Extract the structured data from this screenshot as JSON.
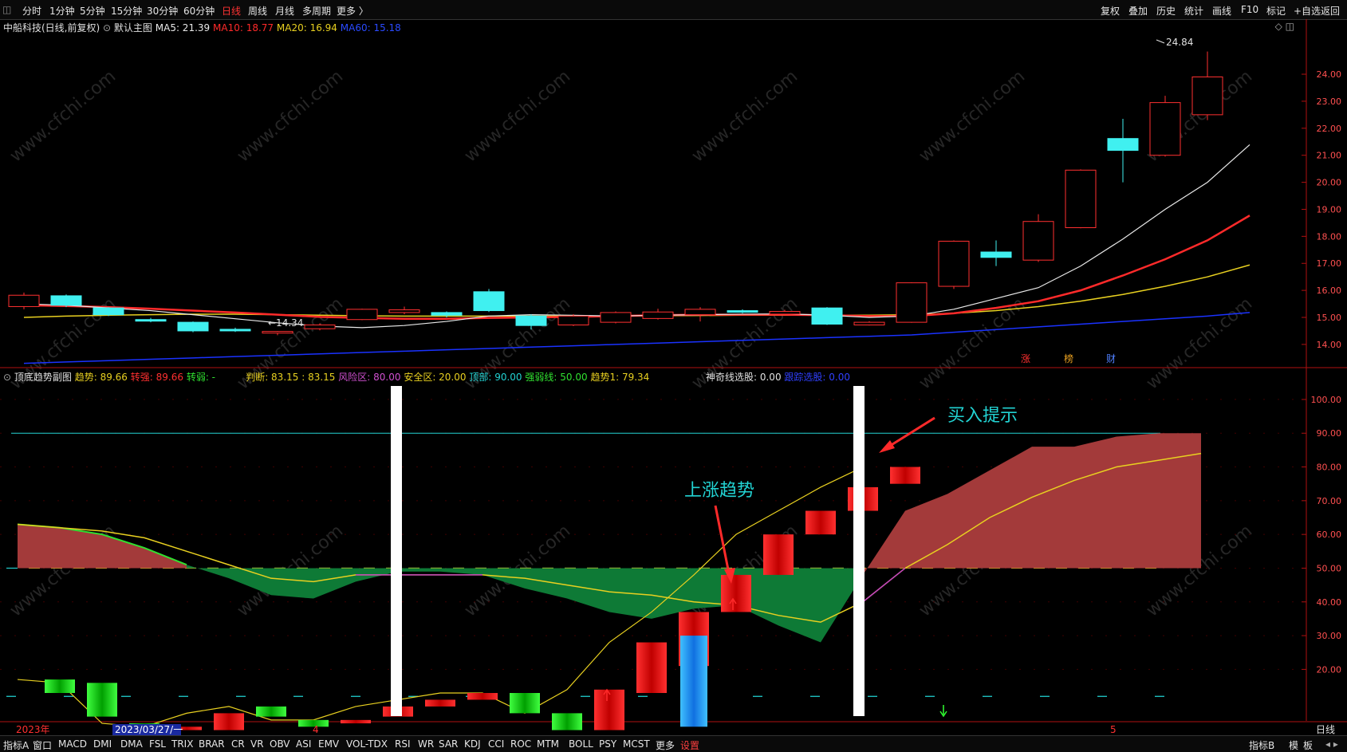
{
  "toolbar": {
    "periods": [
      "分时",
      "1分钟",
      "5分钟",
      "15分钟",
      "30分钟",
      "60分钟",
      "日线",
      "周线",
      "月线",
      "多周期",
      "更多 〉"
    ],
    "active_period": "日线",
    "right_tools": [
      "复权",
      "叠加",
      "历史",
      "统计",
      "画线",
      "F10",
      "标记",
      "+自选",
      "返回"
    ]
  },
  "main_legend": {
    "stock": "中船科技(日线,前复权)",
    "chart_label": "默认主图",
    "ma5": "MA5: 21.39",
    "ma10": "MA10: 18.77",
    "ma20": "MA20: 16.94",
    "ma60": "MA60: 15.18",
    "colors": {
      "ma5": "#e8e8e8",
      "ma10": "#ff2a2a",
      "ma20": "#e8d020",
      "ma60": "#1a32ff"
    }
  },
  "indicator_legend": {
    "name": "顶底趋势副图",
    "trend": "趋势: 89.66",
    "strong": "转强: 89.66",
    "weak": "转弱: -",
    "judge": "判断: 83.15 : 83.15",
    "risk": "风险区: 80.00",
    "safe": "安全区: 20.00",
    "top": "顶部: 90.00",
    "strong_weak_line": "强弱线: 50.00",
    "trend1": "趋势1: 79.34",
    "magic": "神奇线选股: 0.00",
    "follow": "跟踪选股: 0.00"
  },
  "annotations": {
    "buy_hint": "买入提示",
    "uptrend": "上涨趋势",
    "low_label": "←14.34",
    "high_label": "24.84",
    "markers": [
      "涨",
      "榜",
      "财"
    ]
  },
  "date_axis": {
    "year": "2023年",
    "cursor_date": "2023/03/27/一",
    "month4": "4",
    "month5": "5",
    "period_label": "日线"
  },
  "bottom_tabs": [
    "指标A",
    "窗口",
    "MACD",
    "DMI",
    "DMA",
    "FSL",
    "TRIX",
    "BRAR",
    "CR",
    "VR",
    "OBV",
    "ASI",
    "EMV",
    "VOL-TDX",
    "RSI",
    "WR",
    "SAR",
    "KDJ",
    "CCI",
    "ROC",
    "MTM",
    "BOLL",
    "PSY",
    "MCST",
    "更多",
    "设置"
  ],
  "bottom_right": [
    "指标B",
    "模",
    "板"
  ],
  "chart_data": [
    {
      "type": "candlestick",
      "title": "中船科技(日线,前复权)",
      "y_ticks": [
        24.0,
        23.0,
        22.0,
        21.0,
        20.0,
        19.0,
        18.0,
        17.0,
        16.0,
        15.0,
        14.0
      ],
      "ylim": [
        13.2,
        25.3
      ],
      "candles": [
        {
          "o": 15.4,
          "c": 15.82,
          "h": 15.92,
          "l": 15.3
        },
        {
          "o": 15.8,
          "c": 15.45,
          "h": 15.85,
          "l": 15.38
        },
        {
          "o": 15.35,
          "c": 15.1,
          "h": 15.38,
          "l": 15.05
        },
        {
          "o": 14.92,
          "c": 14.9,
          "h": 14.98,
          "l": 14.82
        },
        {
          "o": 14.82,
          "c": 14.5,
          "h": 14.85,
          "l": 14.45
        },
        {
          "o": 14.56,
          "c": 14.5,
          "h": 14.62,
          "l": 14.46
        },
        {
          "o": 14.42,
          "c": 14.48,
          "h": 14.5,
          "l": 14.34
        },
        {
          "o": 14.58,
          "c": 14.72,
          "h": 14.78,
          "l": 14.52
        },
        {
          "o": 14.92,
          "c": 15.3,
          "h": 15.32,
          "l": 14.9
        },
        {
          "o": 15.18,
          "c": 15.28,
          "h": 15.4,
          "l": 15.12
        },
        {
          "o": 15.18,
          "c": 15.08,
          "h": 15.22,
          "l": 15.0
        },
        {
          "o": 15.95,
          "c": 15.25,
          "h": 16.05,
          "l": 15.2
        },
        {
          "o": 15.05,
          "c": 14.7,
          "h": 15.12,
          "l": 14.55
        },
        {
          "o": 14.72,
          "c": 15.05,
          "h": 15.12,
          "l": 14.68
        },
        {
          "o": 14.82,
          "c": 15.18,
          "h": 15.22,
          "l": 14.78
        },
        {
          "o": 14.96,
          "c": 15.2,
          "h": 15.32,
          "l": 14.92
        },
        {
          "o": 15.1,
          "c": 15.3,
          "h": 15.38,
          "l": 14.85
        },
        {
          "o": 15.25,
          "c": 15.22,
          "h": 15.3,
          "l": 15.15
        },
        {
          "o": 15.12,
          "c": 15.22,
          "h": 15.28,
          "l": 15.08
        },
        {
          "o": 15.35,
          "c": 14.75,
          "h": 15.38,
          "l": 14.72
        },
        {
          "o": 14.72,
          "c": 14.82,
          "h": 14.86,
          "l": 14.7
        },
        {
          "o": 14.82,
          "c": 16.28,
          "h": 16.3,
          "l": 14.8
        },
        {
          "o": 16.15,
          "c": 17.82,
          "h": 17.85,
          "l": 16.05
        },
        {
          "o": 17.42,
          "c": 17.22,
          "h": 17.85,
          "l": 16.9
        },
        {
          "o": 17.12,
          "c": 18.55,
          "h": 18.82,
          "l": 17.05
        },
        {
          "o": 18.32,
          "c": 20.45,
          "h": 20.48,
          "l": 18.3
        },
        {
          "o": 21.62,
          "c": 21.18,
          "h": 22.35,
          "l": 20.0
        },
        {
          "o": 21.0,
          "c": 22.95,
          "h": 23.2,
          "l": 20.95
        },
        {
          "o": 22.5,
          "c": 23.9,
          "h": 24.84,
          "l": 22.3
        }
      ],
      "ma5": [
        15.5,
        15.45,
        15.35,
        15.25,
        15.1,
        14.95,
        14.8,
        14.68,
        14.62,
        14.7,
        14.85,
        15.05,
        15.1,
        15.08,
        15.05,
        15.08,
        15.1,
        15.12,
        15.13,
        15.08,
        15.0,
        15.05,
        15.3,
        15.7,
        16.1,
        16.9,
        17.9,
        19.0,
        20.0,
        21.39
      ],
      "ma10": [
        15.45,
        15.42,
        15.38,
        15.32,
        15.25,
        15.18,
        15.1,
        15.02,
        14.98,
        14.95,
        14.95,
        14.98,
        15.0,
        15.02,
        15.05,
        15.08,
        15.1,
        15.1,
        15.1,
        15.08,
        15.05,
        15.05,
        15.15,
        15.35,
        15.6,
        16.0,
        16.55,
        17.15,
        17.85,
        18.77
      ],
      "ma20": [
        15.0,
        15.05,
        15.08,
        15.1,
        15.12,
        15.12,
        15.1,
        15.08,
        15.06,
        15.05,
        15.05,
        15.05,
        15.05,
        15.05,
        15.05,
        15.06,
        15.07,
        15.08,
        15.08,
        15.08,
        15.08,
        15.1,
        15.15,
        15.25,
        15.4,
        15.6,
        15.85,
        16.15,
        16.5,
        16.94
      ],
      "ma60": [
        13.3,
        13.35,
        13.4,
        13.45,
        13.5,
        13.55,
        13.6,
        13.65,
        13.7,
        13.75,
        13.8,
        13.85,
        13.9,
        13.95,
        14.0,
        14.05,
        14.1,
        14.15,
        14.2,
        14.25,
        14.3,
        14.35,
        14.45,
        14.55,
        14.65,
        14.75,
        14.85,
        14.95,
        15.05,
        15.18
      ]
    },
    {
      "type": "area",
      "title": "顶底趋势副图",
      "y_ticks": [
        100,
        90,
        80,
        70,
        60,
        50,
        40,
        30,
        20
      ],
      "ylim": [
        0,
        104
      ],
      "reference_lines": {
        "top": 90,
        "strong_weak": 50,
        "safe": 12
      },
      "trend": [
        63,
        62,
        60,
        56,
        51,
        47,
        42,
        41,
        46,
        49,
        49,
        48,
        44,
        41,
        37,
        35,
        38,
        39,
        33,
        28,
        48,
        67,
        72,
        79,
        86,
        86,
        89,
        90,
        90
      ],
      "trend1": [
        63,
        62,
        61,
        59,
        55,
        51,
        47,
        46,
        48,
        48,
        48,
        48,
        47,
        45,
        43,
        42,
        40,
        39,
        36,
        34,
        40,
        50,
        57,
        65,
        71,
        76,
        80,
        82,
        84
      ],
      "bars": [
        {
          "v": 17,
          "b": 13,
          "color": "green"
        },
        {
          "v": 16,
          "b": 6,
          "color": "green"
        },
        {
          "v": 4,
          "b": 2,
          "color": "green"
        },
        {
          "v": 3,
          "b": 2,
          "color": "red"
        },
        {
          "v": 7,
          "b": 2,
          "color": "red"
        },
        {
          "v": 9,
          "b": 6,
          "color": "green"
        },
        {
          "v": 5,
          "b": 3,
          "color": "green"
        },
        {
          "v": 5,
          "b": 4,
          "color": "red"
        },
        {
          "v": 9,
          "b": 6,
          "color": "red"
        },
        {
          "v": 11,
          "b": 9,
          "color": "red"
        },
        {
          "v": 13,
          "b": 11,
          "color": "red"
        },
        {
          "v": 13,
          "b": 7,
          "color": "green"
        },
        {
          "v": 7,
          "b": 2,
          "color": "green"
        },
        {
          "v": 14,
          "b": 2,
          "color": "red"
        },
        {
          "v": 28,
          "b": 13,
          "color": "red"
        },
        {
          "v": 37,
          "b": 21,
          "color": "red"
        },
        {
          "v": 48,
          "b": 37,
          "color": "red"
        },
        {
          "v": 60,
          "b": 48,
          "color": "red"
        },
        {
          "v": 67,
          "b": 60,
          "color": "red"
        },
        {
          "v": 74,
          "b": 67,
          "color": "red"
        },
        {
          "v": 80,
          "b": 75,
          "color": "red"
        }
      ]
    }
  ]
}
